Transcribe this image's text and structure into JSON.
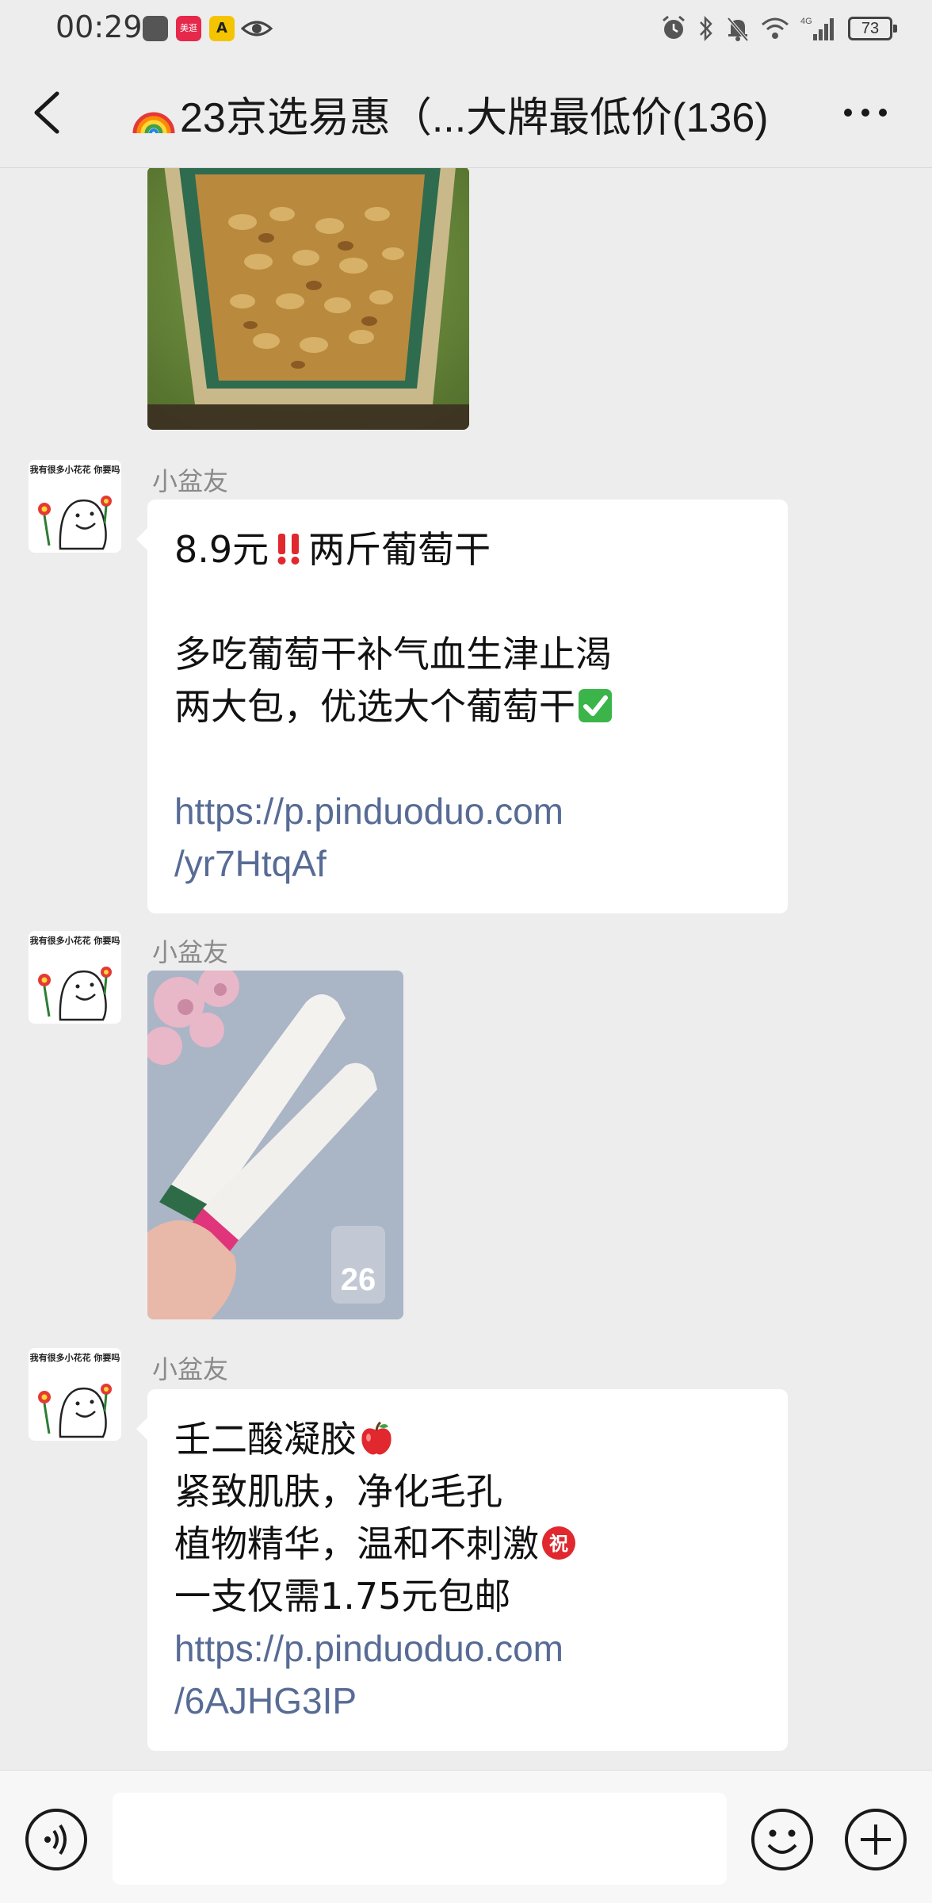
{
  "status_bar": {
    "time": "00:29",
    "app_badge_label": "美逛",
    "battery": "73",
    "network": "4G"
  },
  "header": {
    "title": "23京选易惠（...大牌最低价(136)",
    "title_prefix_icon": "rainbow-emoji"
  },
  "messages": [
    {
      "type": "image",
      "description_icon": "raisins-bag-photo"
    },
    {
      "type": "text",
      "sender": "小盆友",
      "avatar_text": "我有很多小花花 你要吗",
      "lines": [
        {
          "parts": [
            {
              "text": "8.9元"
            },
            {
              "emoji": "double-exclamation"
            },
            {
              "text": "两斤葡萄干"
            }
          ]
        },
        {
          "parts": []
        },
        {
          "parts": [
            {
              "text": "多吃葡萄干补气血生津止渴"
            }
          ]
        },
        {
          "parts": [
            {
              "text": "两大包，优选大个葡萄干"
            },
            {
              "emoji": "check-mark"
            }
          ]
        },
        {
          "parts": []
        },
        {
          "parts": [
            {
              "link": "https://p.pinduoduo.com"
            }
          ]
        },
        {
          "parts": [
            {
              "link": "/yr7HtqAf"
            }
          ]
        }
      ]
    },
    {
      "type": "image",
      "sender": "小盆友",
      "avatar_text": "我有很多小花花 你要吗",
      "image_badge_number": "26"
    },
    {
      "type": "text",
      "sender": "小盆友",
      "avatar_text": "我有很多小花花 你要吗",
      "lines": [
        {
          "parts": [
            {
              "text": "壬二酸凝胶"
            },
            {
              "emoji": "red-apple"
            }
          ]
        },
        {
          "parts": [
            {
              "text": "紧致肌肤，净化毛孔"
            }
          ]
        },
        {
          "parts": [
            {
              "text": "植物精华，温和不刺激"
            },
            {
              "emoji": "congratulations-circle"
            }
          ]
        },
        {
          "parts": [
            {
              "text": "一支仅需1.75元包邮"
            }
          ]
        },
        {
          "parts": [
            {
              "link": "https://p.pinduoduo.com"
            }
          ]
        },
        {
          "parts": [
            {
              "link": "/6AJHG3IP"
            }
          ]
        }
      ]
    }
  ],
  "input_bar": {
    "placeholder": "",
    "voice_icon": "voice-icon",
    "emoji_icon": "emoji-icon",
    "add_icon": "add-icon"
  },
  "colors": {
    "background": "#ededed",
    "bubble": "#ffffff",
    "link": "#576b95",
    "sender_name": "#8a8a8a"
  }
}
